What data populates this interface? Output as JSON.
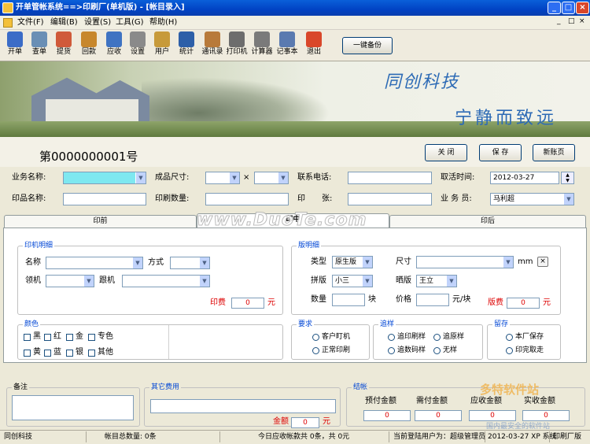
{
  "window": {
    "title": "开单管帐系统==>印刷厂(单机版) - [帐目录入]"
  },
  "menu": [
    "文件(F)",
    "编辑(B)",
    "设置(S)",
    "工具(G)",
    "帮助(H)"
  ],
  "toolbar": {
    "items": [
      {
        "label": "开单",
        "icon": "create-order-icon",
        "color": "#3b6cc7"
      },
      {
        "label": "查单",
        "icon": "search-order-icon",
        "color": "#6a8fb5"
      },
      {
        "label": "提货",
        "icon": "pickup-icon",
        "color": "#d05a3a"
      },
      {
        "label": "回款",
        "icon": "payment-back-icon",
        "color": "#c7872c"
      },
      {
        "label": "应收",
        "icon": "receivable-icon",
        "color": "#3f73c2"
      },
      {
        "label": "设置",
        "icon": "settings-icon",
        "color": "#8a8a8a"
      },
      {
        "label": "用户",
        "icon": "user-icon",
        "color": "#c79a3a"
      },
      {
        "label": "统计",
        "icon": "statistics-icon",
        "color": "#2d5fa8"
      },
      {
        "label": "通讯录",
        "icon": "contacts-icon",
        "color": "#b87a3a"
      },
      {
        "label": "打印机",
        "icon": "printer-icon",
        "color": "#6d6d6d"
      },
      {
        "label": "计算器",
        "icon": "calculator-icon",
        "color": "#7a7a7a"
      },
      {
        "label": "记事本",
        "icon": "notepad-icon",
        "color": "#5a7ab0"
      },
      {
        "label": "退出",
        "icon": "exit-icon",
        "color": "#d9472a"
      }
    ],
    "backup_label": "一键备份"
  },
  "banner": {
    "logo_text": "同创科技",
    "motto": "宁静而致远"
  },
  "form": {
    "serial": "第0000000001号",
    "buttons": {
      "close": "关 闭",
      "save": "保 存",
      "new": "新账页"
    },
    "row1": {
      "business_name_label": "业务名称:",
      "size_label": "成品尺寸:",
      "times": "×",
      "phone_label": "联系电话:",
      "pickup_time_label": "取活时间:",
      "pickup_time_value": "2012-03-27"
    },
    "row2": {
      "product_name_label": "印品名称:",
      "print_qty_label": "印刷数量:",
      "print_label": "印",
      "sheet_label": "张:",
      "salesman_label": "业 务 员:",
      "salesman_value": "马利超"
    }
  },
  "tabs": [
    "印前",
    "印中",
    "印后"
  ],
  "active_tab": "印中",
  "press": {
    "title": "印机明细",
    "name_label": "名称",
    "method_label": "方式",
    "lead_label": "领机",
    "follow_label": "跟机",
    "fee_label": "印费",
    "fee_value": "0",
    "unit": "元"
  },
  "plate": {
    "title": "版明细",
    "type_label": "类型",
    "type_value": "原生版",
    "size_label": "尺寸",
    "size_unit": "mm",
    "x_btn": "×",
    "imposition_label": "拼版",
    "imposition_value": "小三",
    "exposure_label": "晒版",
    "exposure_value": "王立",
    "qty_label": "数量",
    "qty_unit": "块",
    "price_label": "价格",
    "price_unit": "元/块",
    "fee_label": "版费",
    "fee_value": "0",
    "unit": "元"
  },
  "colors": {
    "title": "颜色",
    "options": [
      "黑",
      "红",
      "金",
      "专色",
      "黄",
      "蓝",
      "银",
      "其他"
    ]
  },
  "requirement": {
    "title": "要求",
    "options": [
      "客户盯机",
      "正常印刷"
    ]
  },
  "chase": {
    "title": "追样",
    "options": [
      "追印刷样",
      "追原样",
      "追数码样",
      "无样"
    ]
  },
  "keep": {
    "title": "留存",
    "options": [
      "本厂保存",
      "印完取走"
    ]
  },
  "bottom": {
    "remark_title": "备注",
    "other_fee_title": "其它费用",
    "amount_label": "金额",
    "amount_value": "0",
    "unit": "元",
    "settle_title": "结帐",
    "settle_labels": [
      "预付金额",
      "需付金额",
      "应收金额",
      "实收金额"
    ],
    "settle_values": [
      "0",
      "0",
      "0",
      "0"
    ]
  },
  "status": {
    "company": "同创科技",
    "total_accounts": "帐目总数量: 0条",
    "today_receivable": "今日应收帐款共 0条，共 0元",
    "current_user": "当前登陆用户为：超级管理员",
    "date_system": "2012-03-27 XP 系统",
    "edition": "印刷厂版"
  },
  "watermarks": {
    "center": "www.DuoTe.com",
    "corner": "多特软件站",
    "corner_sub": "国内最安全的软件站"
  }
}
